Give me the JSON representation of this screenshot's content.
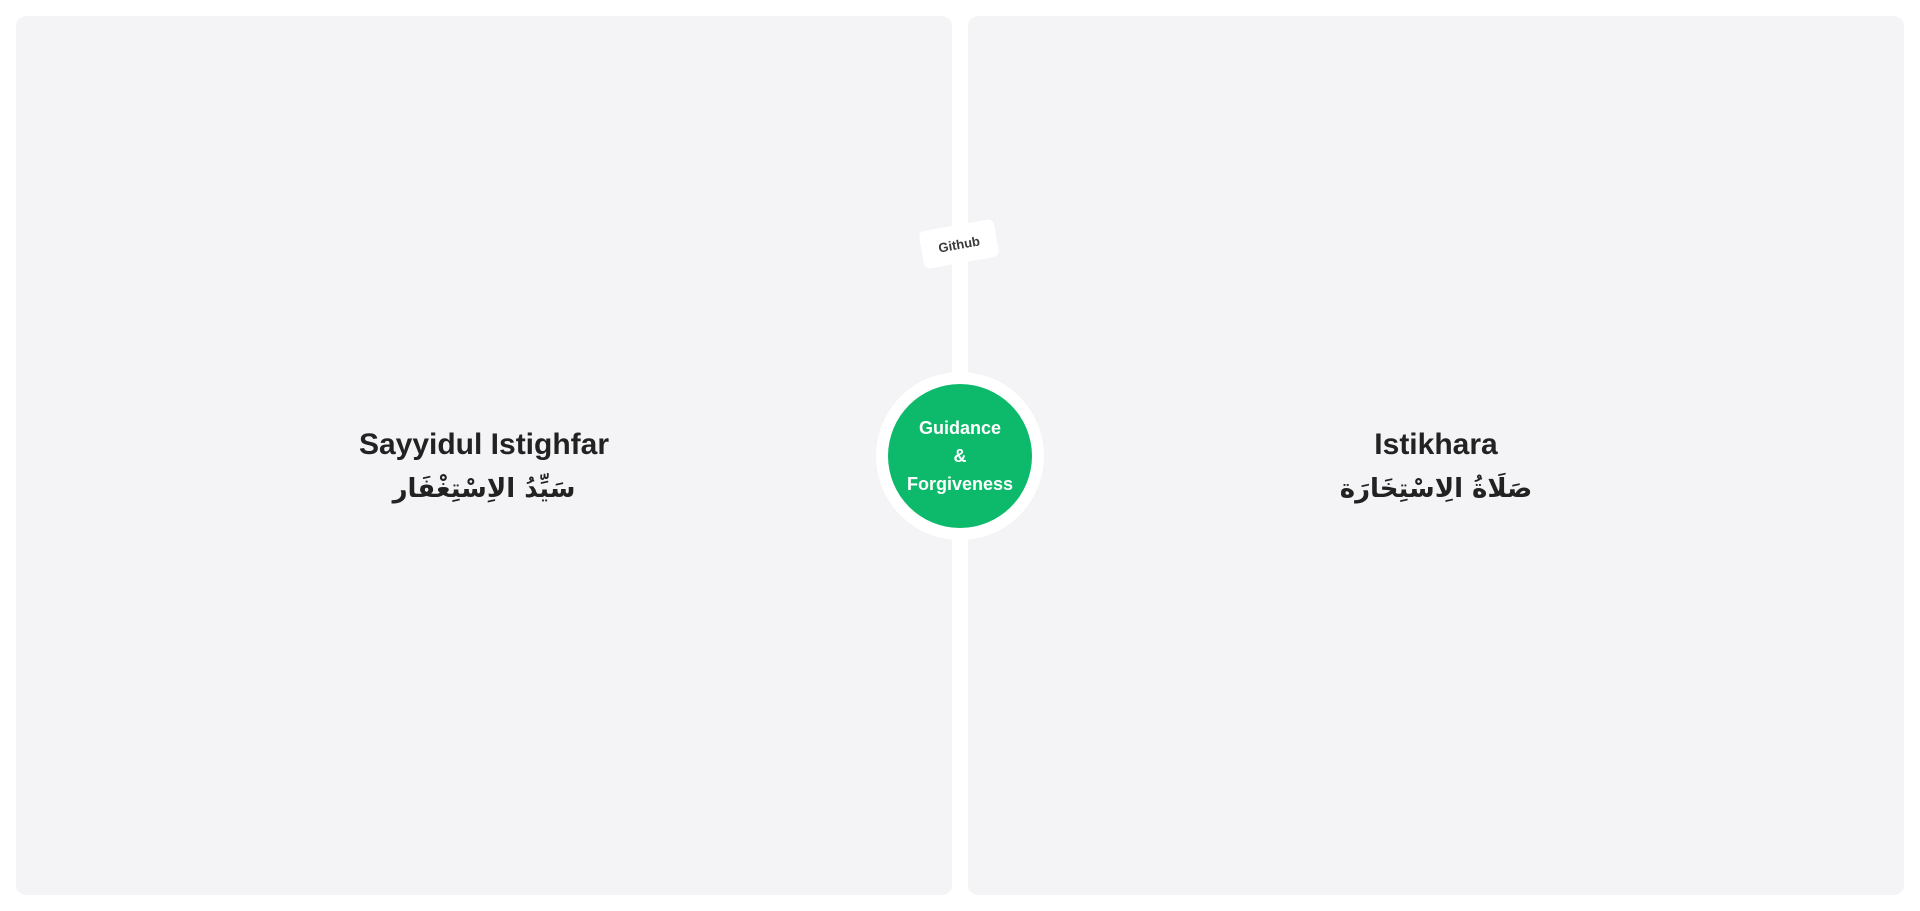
{
  "panels": {
    "left": {
      "title": "Sayyidul Istighfar",
      "arabic": "سَيِّدُ الاِسْتِغْفَار"
    },
    "right": {
      "title": "Istikhara",
      "arabic": "صَلَاةُ الِاسْتِخَارَة"
    }
  },
  "github_label": "Github",
  "center": {
    "line1": "Guidance",
    "line2": "&",
    "line3": "Forgiveness",
    "color": "#0dba6b"
  },
  "colors": {
    "panel_bg": "#f4f4f6",
    "text": "#222222"
  }
}
